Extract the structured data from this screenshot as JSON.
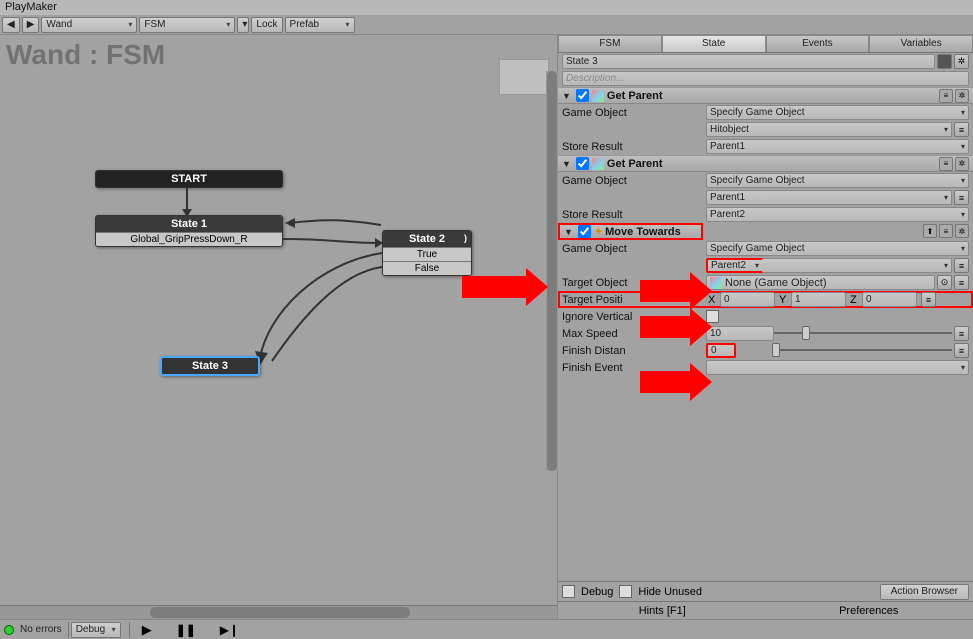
{
  "window_title": "PlayMaker",
  "toolbar": {
    "wand": "Wand",
    "fsm": "FSM",
    "lock": "Lock",
    "prefab": "Prefab"
  },
  "graph": {
    "title": "Wand : FSM",
    "start": "START",
    "state1": {
      "title": "State 1",
      "sub": "Global_GripPressDown_R"
    },
    "state2": {
      "title": "State 2",
      "t": "True",
      "f": "False"
    },
    "state3": {
      "title": "State 3"
    }
  },
  "tabs": {
    "fsm": "FSM",
    "state": "State",
    "events": "Events",
    "vars": "Variables"
  },
  "state_name": "State 3",
  "desc_placeholder": "Description...",
  "sec1": {
    "title": "Get Parent",
    "game_object": "Game Object",
    "go_val": "Specify Game Object",
    "go_obj": "Hitobject",
    "store": "Store Result",
    "store_val": "Parent1"
  },
  "sec2": {
    "title": "Get Parent",
    "game_object": "Game Object",
    "go_val": "Specify Game Object",
    "go_obj": "Parent1",
    "store": "Store Result",
    "store_val": "Parent2"
  },
  "sec3": {
    "title": "Move Towards",
    "game_object": "Game Object",
    "go_val": "Specify Game Object",
    "parent": "Parent2",
    "target_obj": "Target Object",
    "target_obj_val": "None (Game Object)",
    "target_pos": "Target Positi",
    "x": "X",
    "xv": "0",
    "y": "Y",
    "yv": "1",
    "z": "Z",
    "zv": "0",
    "ignore": "Ignore Vertical",
    "max_speed": "Max Speed",
    "max_speed_v": "10",
    "finish_dist": "Finish Distan",
    "finish_dist_v": "0",
    "finish_event": "Finish Event"
  },
  "footer": {
    "debug": "Debug",
    "hide": "Hide Unused",
    "browser": "Action Browser",
    "hints": "Hints [F1]",
    "prefs": "Preferences"
  },
  "status": {
    "errors": "No errors",
    "debug": "Debug"
  }
}
